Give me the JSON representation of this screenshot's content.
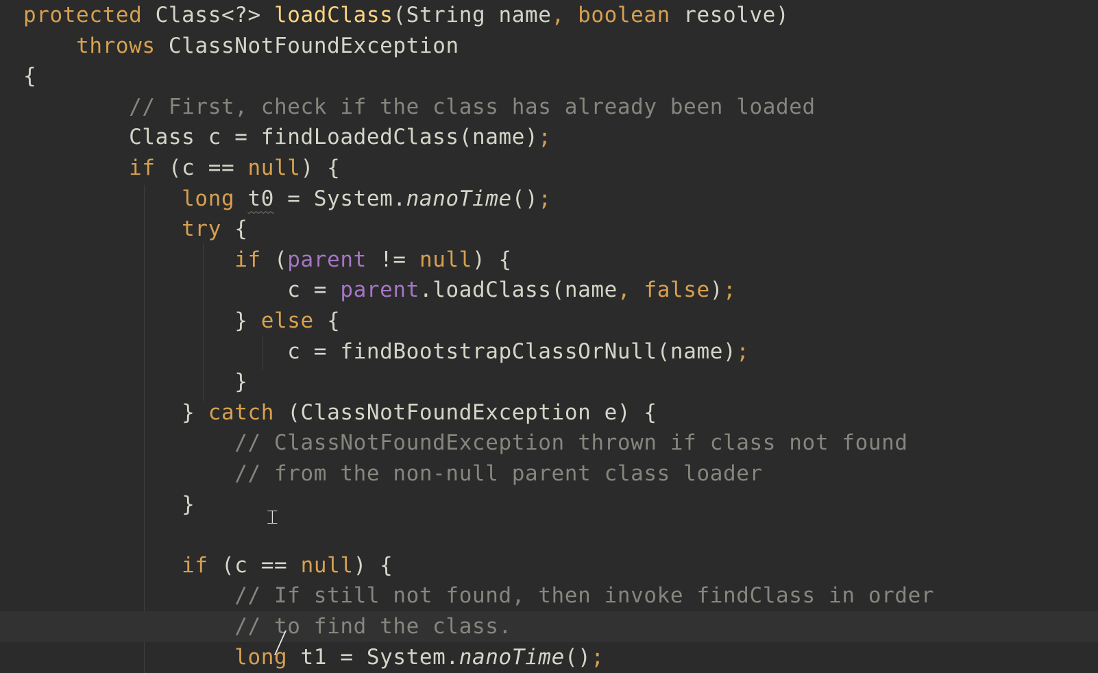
{
  "editor": {
    "theme_colors": {
      "background": "#2b2b2b",
      "current_line": "#323232",
      "keyword": "#d6a050",
      "method_declaration": "#ffd480",
      "comment": "#85867d",
      "field": "#a675c4",
      "default_text": "#d4d4c8"
    },
    "cursor_icon": "text-cursor-icon",
    "lines": [
      {
        "indent": "",
        "tokens": [
          {
            "c": "kw",
            "t": "protected"
          },
          {
            "t": " Class<?> "
          },
          {
            "c": "fn",
            "t": "loadClass"
          },
          {
            "t": "(String name"
          },
          {
            "c": "kw",
            "t": ", boolean"
          },
          {
            "t": " resolve)"
          }
        ]
      },
      {
        "indent": "    ",
        "tokens": [
          {
            "c": "kw",
            "t": "throws"
          },
          {
            "t": " ClassNotFoundException"
          }
        ]
      },
      {
        "indent": "",
        "tokens": [
          {
            "t": "{"
          }
        ]
      },
      {
        "indent": "        ",
        "tokens": [
          {
            "c": "cm",
            "t": "// First, check if the class has already been loaded"
          }
        ]
      },
      {
        "indent": "        ",
        "tokens": [
          {
            "t": "Class c = findLoadedClass(name)"
          },
          {
            "c": "kw",
            "t": ";"
          }
        ]
      },
      {
        "indent": "        ",
        "tokens": [
          {
            "c": "kw",
            "t": "if"
          },
          {
            "t": " (c == "
          },
          {
            "c": "kw",
            "t": "null"
          },
          {
            "t": ") {"
          }
        ]
      },
      {
        "indent": "            ",
        "tokens": [
          {
            "c": "kw",
            "t": "long"
          },
          {
            "t": " "
          },
          {
            "c": "typo",
            "t": "t0"
          },
          {
            "t": " = System."
          },
          {
            "c": "it",
            "t": "nanoTime"
          },
          {
            "t": "()"
          },
          {
            "c": "kw",
            "t": ";"
          }
        ]
      },
      {
        "indent": "            ",
        "tokens": [
          {
            "c": "kw",
            "t": "try"
          },
          {
            "t": " {"
          }
        ]
      },
      {
        "indent": "                ",
        "tokens": [
          {
            "c": "kw",
            "t": "if"
          },
          {
            "t": " ("
          },
          {
            "c": "fld",
            "t": "parent"
          },
          {
            "t": " != "
          },
          {
            "c": "kw",
            "t": "null"
          },
          {
            "t": ") {"
          }
        ]
      },
      {
        "indent": "                    ",
        "tokens": [
          {
            "t": "c = "
          },
          {
            "c": "fld",
            "t": "parent"
          },
          {
            "t": ".loadClass(name"
          },
          {
            "c": "kw",
            "t": ", false"
          },
          {
            "t": ")"
          },
          {
            "c": "kw",
            "t": ";"
          }
        ]
      },
      {
        "indent": "                ",
        "tokens": [
          {
            "t": "} "
          },
          {
            "c": "kw",
            "t": "else"
          },
          {
            "t": " {"
          }
        ]
      },
      {
        "indent": "                    ",
        "tokens": [
          {
            "t": "c = findBootstrapClassOrNull(name)"
          },
          {
            "c": "kw",
            "t": ";"
          }
        ]
      },
      {
        "indent": "                ",
        "tokens": [
          {
            "t": "}"
          }
        ]
      },
      {
        "indent": "            ",
        "tokens": [
          {
            "t": "} "
          },
          {
            "c": "kw",
            "t": "catch"
          },
          {
            "t": " (ClassNotFoundException e) {"
          }
        ]
      },
      {
        "indent": "                ",
        "tokens": [
          {
            "c": "cm",
            "t": "// ClassNotFoundException thrown if class not found"
          }
        ]
      },
      {
        "indent": "                ",
        "tokens": [
          {
            "c": "cm",
            "t": "// from the non-null parent class loader"
          }
        ]
      },
      {
        "indent": "            ",
        "tokens": [
          {
            "t": "}"
          }
        ]
      },
      {
        "indent": "",
        "tokens": []
      },
      {
        "indent": "            ",
        "tokens": [
          {
            "c": "kw",
            "t": "if"
          },
          {
            "t": " (c == "
          },
          {
            "c": "kw",
            "t": "null"
          },
          {
            "t": ") {"
          }
        ]
      },
      {
        "indent": "                ",
        "tokens": [
          {
            "c": "cm",
            "t": "// If still not found, then invoke findClass in order"
          }
        ]
      },
      {
        "indent": "                ",
        "current": true,
        "tokens": [
          {
            "c": "cm",
            "t": "// to find the class."
          }
        ]
      },
      {
        "indent": "                ",
        "tokens": [
          {
            "c": "kw",
            "t": "long"
          },
          {
            "t": " t1 = System."
          },
          {
            "c": "it",
            "t": "nanoTime"
          },
          {
            "t": "()"
          },
          {
            "c": "kw",
            "t": ";"
          }
        ]
      }
    ]
  }
}
